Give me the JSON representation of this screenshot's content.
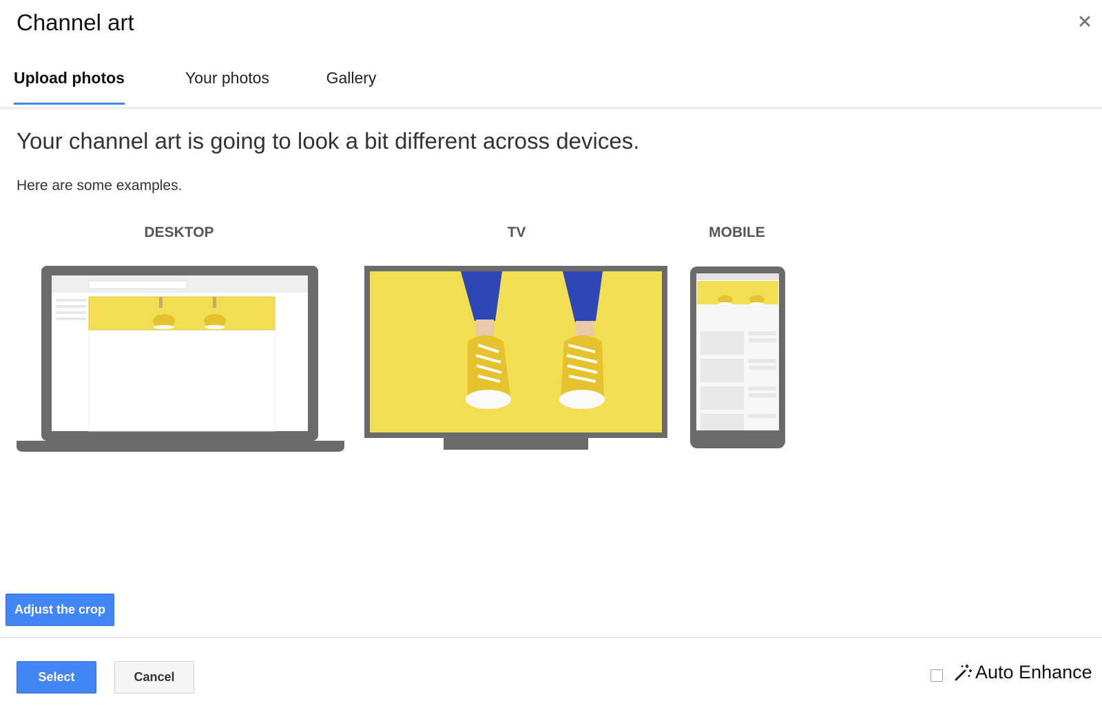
{
  "dialog": {
    "title": "Channel art",
    "close_icon": "close-icon"
  },
  "tabs": [
    {
      "label": "Upload photos",
      "active": true
    },
    {
      "label": "Your photos",
      "active": false
    },
    {
      "label": "Gallery",
      "active": false
    }
  ],
  "content": {
    "headline": "Your channel art is going to look a bit different across devices.",
    "subtext": "Here are some examples."
  },
  "devices": [
    {
      "label": "DESKTOP",
      "icon": "laptop-preview"
    },
    {
      "label": "TV",
      "icon": "tv-preview"
    },
    {
      "label": "MOBILE",
      "icon": "phone-preview"
    }
  ],
  "colors": {
    "accent": "#4285f4",
    "device_frame": "#6b6b6b",
    "banner_yellow": "#f2de53"
  },
  "buttons": {
    "adjust_crop": "Adjust the crop",
    "select": "Select",
    "cancel": "Cancel"
  },
  "auto_enhance": {
    "label": "Auto Enhance",
    "checked": false,
    "icon": "magic-wand-icon"
  }
}
